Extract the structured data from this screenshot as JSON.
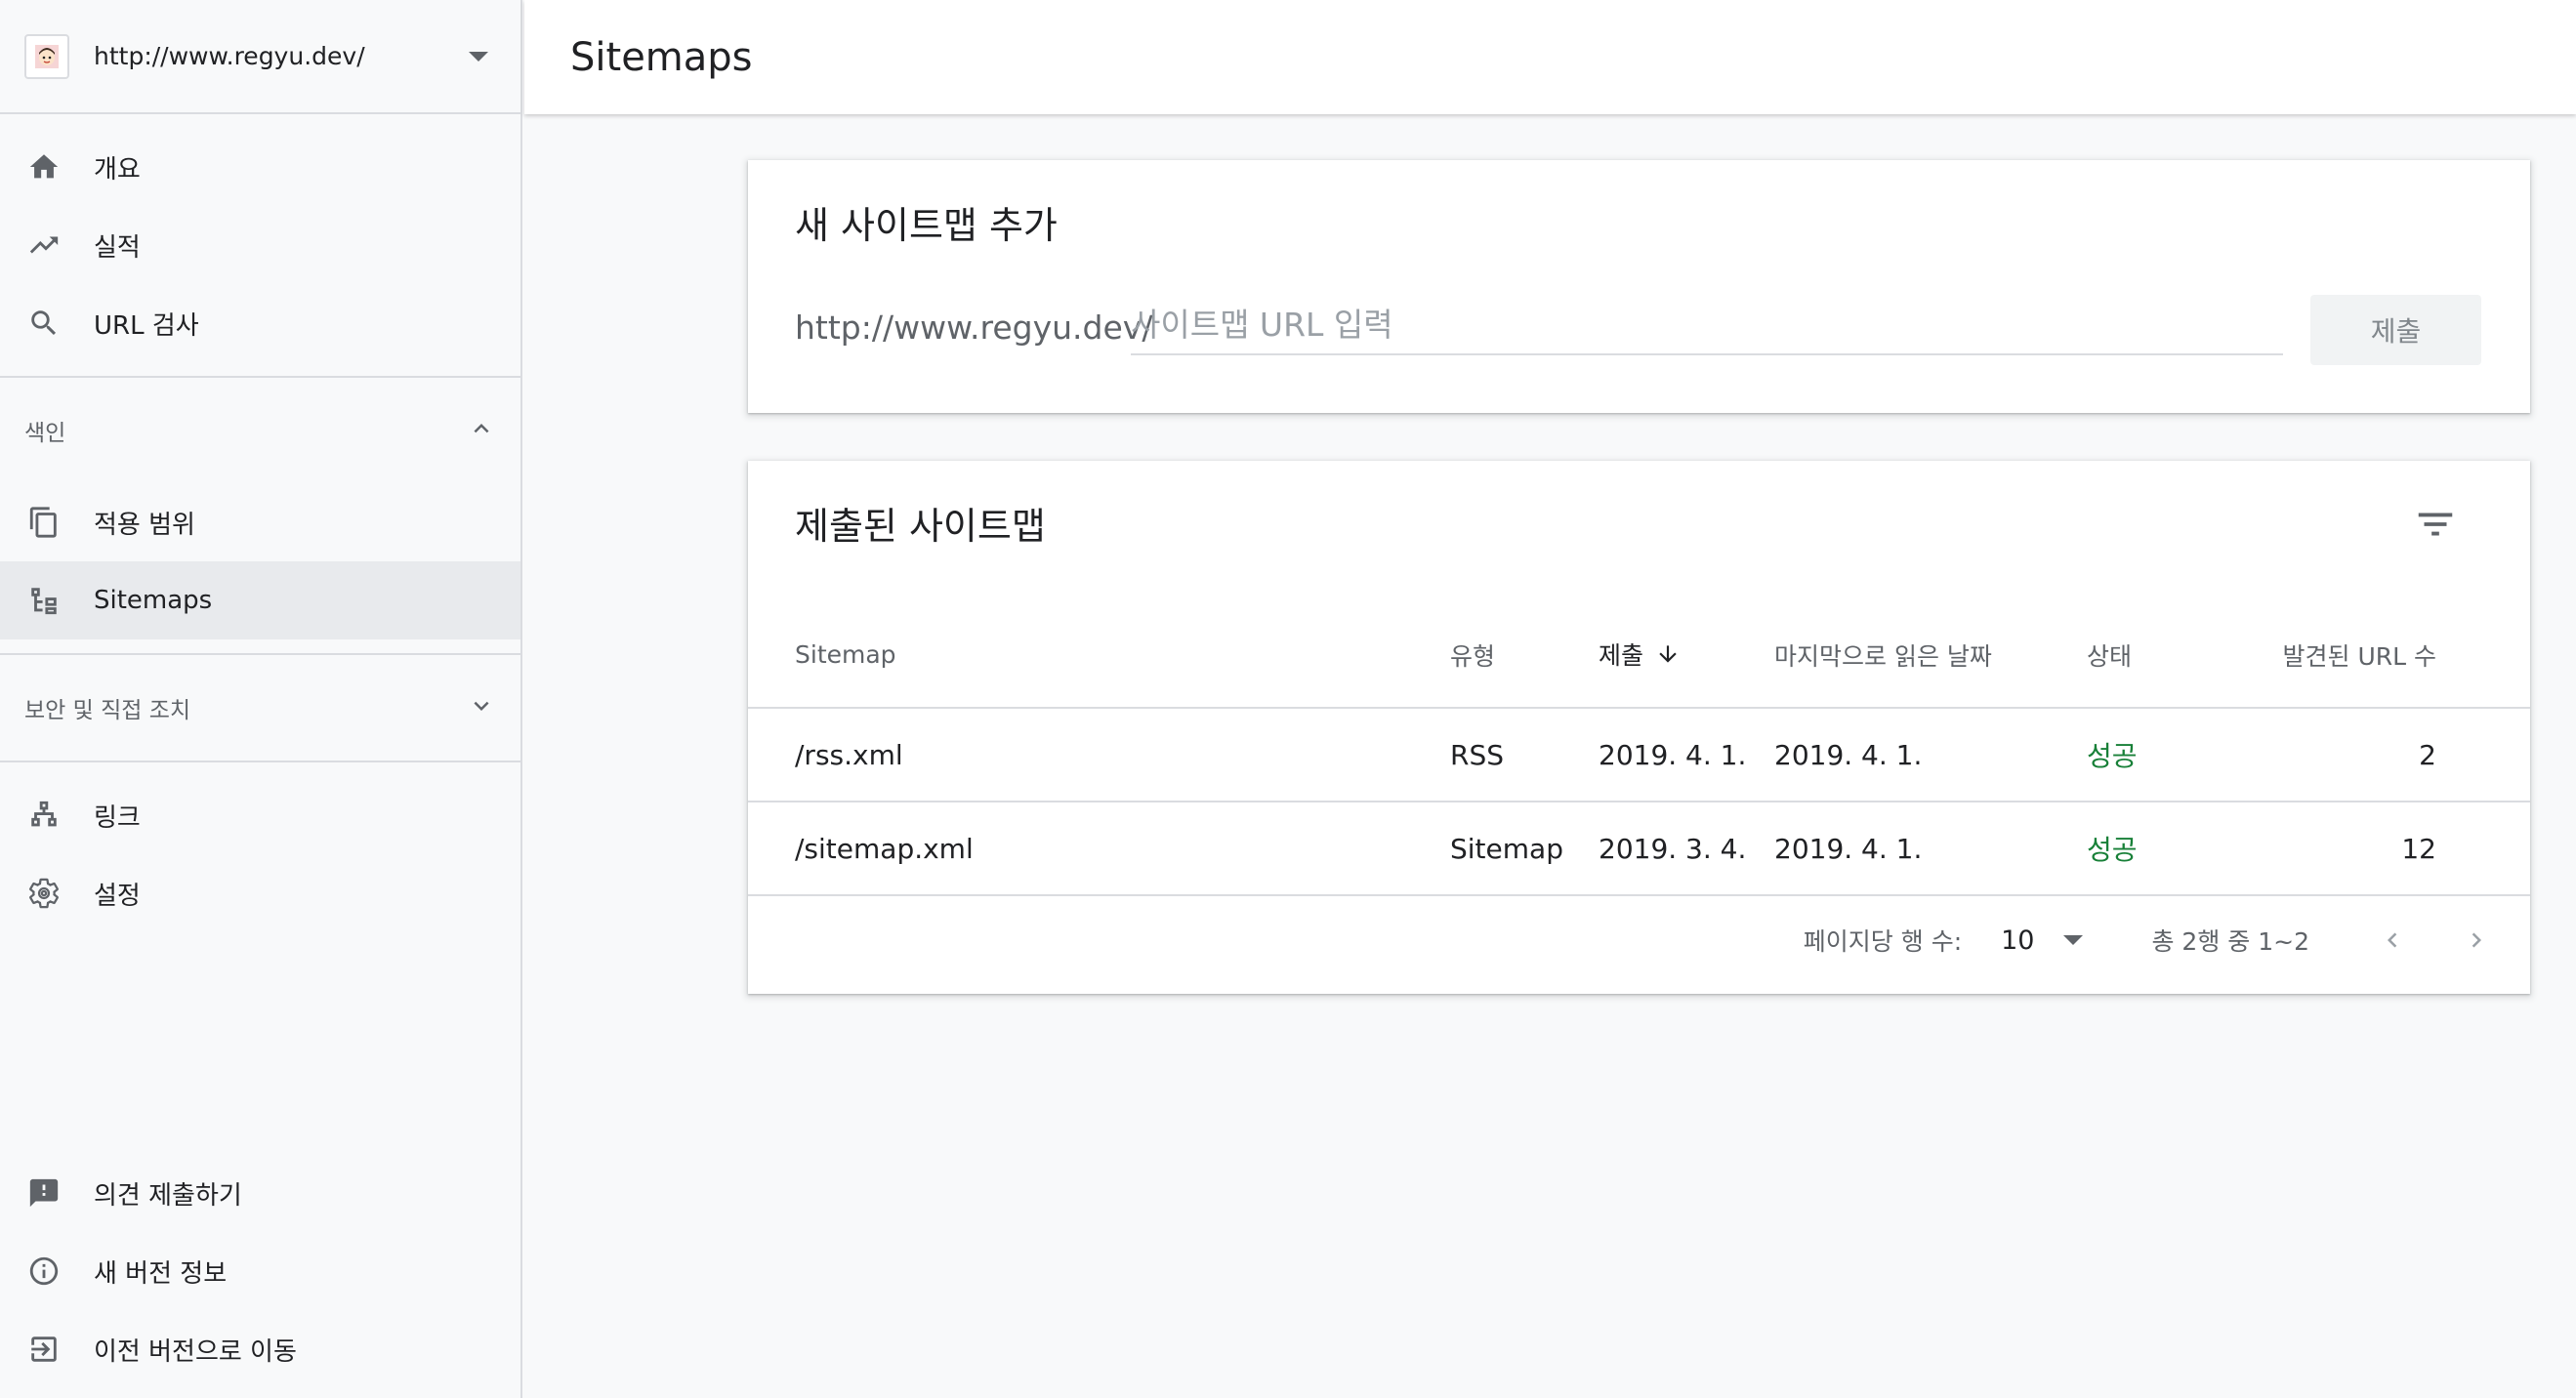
{
  "property": {
    "url": "http://www.regyu.dev/"
  },
  "nav": {
    "main": [
      {
        "label": "개요"
      },
      {
        "label": "실적"
      },
      {
        "label": "URL 검사"
      }
    ],
    "index_section": {
      "label": "색인",
      "items": [
        {
          "label": "적용 범위"
        },
        {
          "label": "Sitemaps"
        }
      ]
    },
    "security_section": {
      "label": "보안 및 직접 조치"
    },
    "extra": [
      {
        "label": "링크"
      },
      {
        "label": "설정"
      }
    ],
    "bottom": [
      {
        "label": "의견 제출하기"
      },
      {
        "label": "새 버전 정보"
      },
      {
        "label": "이전 버전으로 이동"
      }
    ]
  },
  "header": {
    "title": "Sitemaps"
  },
  "add_card": {
    "title": "새 사이트맵 추가",
    "prefix": "http://www.regyu.dev/",
    "placeholder": "사이트맵 URL 입력",
    "submit_label": "제출"
  },
  "submitted_card": {
    "title": "제출된 사이트맵",
    "columns": {
      "sitemap": "Sitemap",
      "type": "유형",
      "submitted": "제출",
      "last_read": "마지막으로 읽은 날짜",
      "status": "상태",
      "discovered": "발견된 URL 수"
    },
    "rows": [
      {
        "sitemap": "/rss.xml",
        "type": "RSS",
        "submitted": "2019. 4. 1.",
        "last_read": "2019. 4. 1.",
        "status": "성공",
        "discovered": "2"
      },
      {
        "sitemap": "/sitemap.xml",
        "type": "Sitemap",
        "submitted": "2019. 3. 4.",
        "last_read": "2019. 4. 1.",
        "status": "성공",
        "discovered": "12"
      }
    ],
    "pager": {
      "rows_label": "페이지당 행 수:",
      "rows_value": "10",
      "range": "총 2행 중 1~2"
    }
  },
  "colors": {
    "success": "#188038",
    "active_bg": "#e8eaed",
    "icon": "#5f6368"
  }
}
